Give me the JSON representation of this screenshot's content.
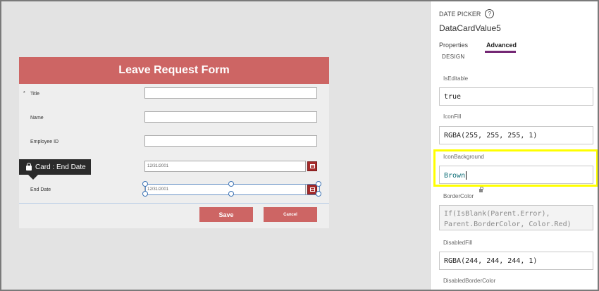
{
  "form": {
    "header_title": "Leave Request Form",
    "required_marker": "*",
    "fields": {
      "title_label": "Title",
      "name_label": "Name",
      "employee_id_label": "Employee ID",
      "start_date_value": "12/31/2001",
      "end_date_label": "End Date",
      "end_date_value": "12/31/2001"
    },
    "save_label": "Save",
    "cancel_label": "Cancel",
    "tooltip_text": "Card : End Date"
  },
  "panel": {
    "control_type": "DATE PICKER",
    "help_icon": "?",
    "control_name": "DataCardValue5",
    "tabs": [
      {
        "label": "Properties",
        "active": false
      },
      {
        "label": "Advanced",
        "active": true
      }
    ],
    "section_title": "DESIGN",
    "properties": {
      "iseditable_label": "IsEditable",
      "iseditable_value": "true",
      "iconfill_label": "IconFill",
      "iconfill_value": "RGBA(255, 255, 255, 1)",
      "iconbackground_label": "IconBackground",
      "iconbackground_value": "Brown",
      "bordercolor_label": "BorderColor",
      "bordercolor_value_line1": "If(IsBlank(Parent.Error),",
      "bordercolor_value_line2": "Parent.BorderColor, Color.Red)",
      "disabledfill_label": "DisabledFill",
      "disabledfill_value": "RGBA(244, 244, 244, 1)",
      "disabledbordercolor_label": "DisabledBorderColor"
    }
  },
  "colors": {
    "form_header": "#cd6564",
    "date_button": "#a52a2a",
    "highlight": "#ffff00",
    "tab_accent": "#742774"
  }
}
